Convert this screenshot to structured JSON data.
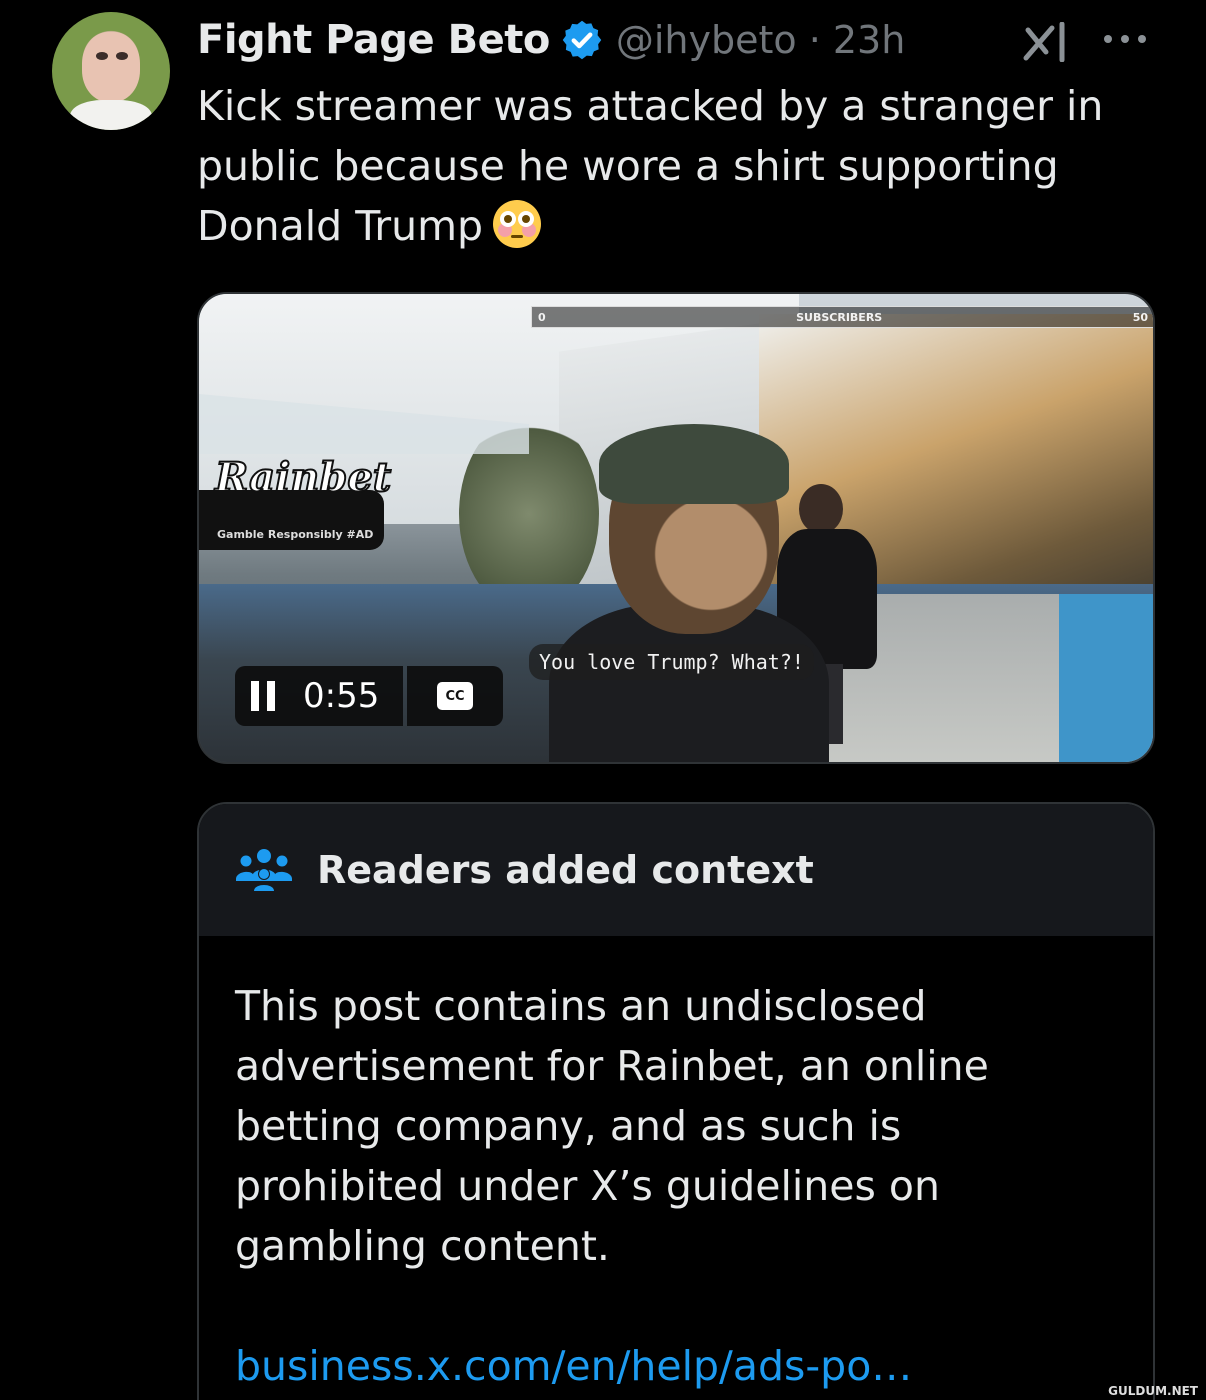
{
  "author": {
    "name": "Fight Page Beto",
    "handle": "@ihybeto",
    "time": "23h",
    "handle_time": "@ihybeto · 23h"
  },
  "tweet": {
    "text": "Kick streamer was attacked by a stranger in public because he wore a shirt supporting Donald Trump",
    "emoji": "flushed-face-emoji"
  },
  "video": {
    "overlay_left": "0",
    "overlay_center": "SUBSCRIBERS",
    "overlay_right": "50",
    "ad_brand": "Rainbet",
    "ad_tagline": "Gamble Responsibly #AD",
    "subtitle": "You love Trump? What?!",
    "time": "0:55",
    "cc_label": "CC"
  },
  "community_note": {
    "title": "Readers added context",
    "body": "This post contains an undisclosed advertisement for Rainbet, an online betting company, and as such is prohibited under X’s guidelines on gambling content.",
    "link": "business.x.com/en/help/ads-po…"
  },
  "watermark": "GULDUM.NET",
  "colors": {
    "background": "#000000",
    "text": "#e7e9ea",
    "muted": "#71767b",
    "accent": "#1d9bf0",
    "border": "#2f3336",
    "note_header": "#16181c"
  }
}
